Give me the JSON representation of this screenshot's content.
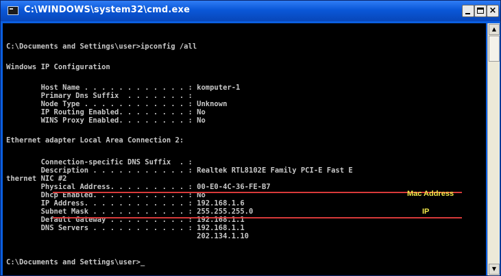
{
  "window": {
    "title": "C:\\WINDOWS\\system32\\cmd.exe",
    "minimize_label": "-",
    "close_label": "×"
  },
  "console": {
    "lines": [
      "C:\\Documents and Settings\\user>ipconfig /all",
      "Windows IP Configuration",
      "        Host Name . . . . . . . . . . . . : komputer-1",
      "        Primary Dns Suffix  . . . . . . . :",
      "        Node Type . . . . . . . . . . . . : Unknown",
      "        IP Routing Enabled. . . . . . . . : No",
      "        WINS Proxy Enabled. . . . . . . . : No",
      "Ethernet adapter Local Area Connection 2:",
      "        Connection-specific DNS Suffix  . :",
      "        Description . . . . . . . . . . . : Realtek RTL8102E Family PCI-E Fast E",
      "thernet NIC #2",
      "        Physical Address. . . . . . . . . : 00-E0-4C-36-FE-B7",
      "        Dhcp Enabled. . . . . . . . . . . : No",
      "        IP Address. . . . . . . . . . . . : 192.168.1.6",
      "        Subnet Mask . . . . . . . . . . . : 255.255.255.0",
      "        Default Gateway . . . . . . . . . : 192.168.1.1",
      "        DNS Servers . . . . . . . . . . . : 192.168.1.1",
      "                                            202.134.1.10",
      "C:\\Documents and Settings\\user>_"
    ]
  },
  "annotations": {
    "mac_label": "Mac Address",
    "ip_label": "IP"
  },
  "colors": {
    "annotation_text": "#f3e94a",
    "underline": "#d83a3a",
    "console_bg": "#000000",
    "console_text": "#c8c8c8"
  }
}
